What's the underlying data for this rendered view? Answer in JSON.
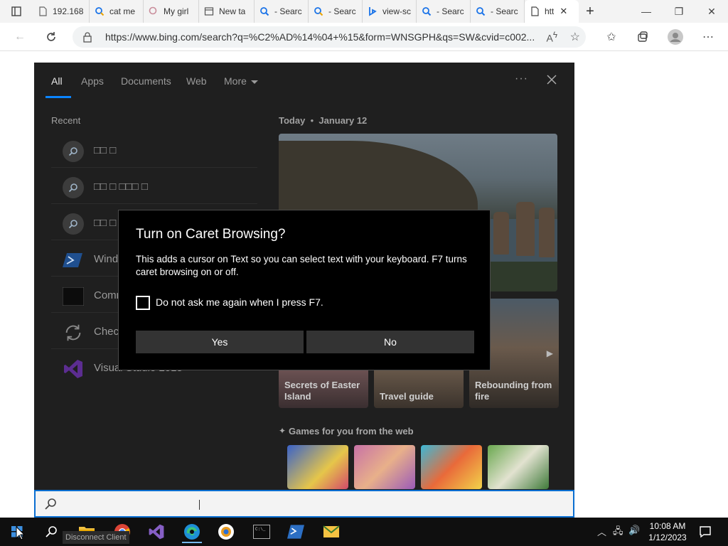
{
  "browser": {
    "tabs": [
      {
        "label": "192.168",
        "icon": "page-icon"
      },
      {
        "label": "cat me",
        "icon": "search-icon"
      },
      {
        "label": "My girl",
        "icon": "search-icon"
      },
      {
        "label": "New ta",
        "icon": "newtab-icon"
      },
      {
        "label": "- Searc",
        "icon": "search-icon"
      },
      {
        "label": "- Searc",
        "icon": "search-icon"
      },
      {
        "label": "view-sc",
        "icon": "bing-icon"
      },
      {
        "label": "- Searc",
        "icon": "search-icon"
      },
      {
        "label": "- Searc",
        "icon": "search-icon"
      },
      {
        "label": "htt",
        "icon": "page-icon",
        "active": true
      }
    ],
    "new_tab": "+",
    "url": "https://www.bing.com/search?q=%C2%AD%14%04+%15&form=WNSGPH&qs=SW&cvid=c002..."
  },
  "search_panel": {
    "tabs": [
      "All",
      "Apps",
      "Documents",
      "Web",
      "More"
    ],
    "recent_heading": "Recent",
    "recent_items": [
      {
        "label": "□□ □",
        "icon": "search-icon"
      },
      {
        "label": "□□ □ □□□ □",
        "icon": "search-icon"
      },
      {
        "label": "□□ □",
        "icon": "search-icon"
      },
      {
        "label": "Wind",
        "icon": "powershell-icon"
      },
      {
        "label": "Comm",
        "icon": "command-prompt-icon"
      },
      {
        "label": "Chec",
        "icon": "refresh-icon"
      },
      {
        "label": "Visual Studio 2015",
        "icon": "visual-studio-icon"
      }
    ],
    "today_label": "Today",
    "today_date": "January 12",
    "cards": [
      {
        "caption": "Secrets of Easter Island"
      },
      {
        "caption": "Travel guide"
      },
      {
        "caption": "Rebounding from fire"
      }
    ],
    "games_heading": "Games for you from the web"
  },
  "dialog": {
    "title": "Turn on Caret Browsing?",
    "body": "This adds a cursor on Text so you can select text with your keyboard. F7 turns caret browsing on or off.",
    "checkbox_label": "Do not ask me again when I press F7.",
    "checkbox_checked": false,
    "yes_label": "Yes",
    "no_label": "No"
  },
  "taskbar": {
    "time": "10:08 AM",
    "date": "1/12/2023",
    "tooltip": "Disconnect Client",
    "apps": [
      "file-explorer-icon",
      "chrome-icon",
      "visual-studio-icon",
      "edge-icon",
      "browser-icon",
      "terminal-icon",
      "powershell-icon",
      "mail-icon"
    ]
  },
  "colors": {
    "accent": "#0a84ff",
    "panel_bg": "#1f1f1f",
    "dialog_bg": "#000000",
    "dialog_button": "#333333"
  }
}
